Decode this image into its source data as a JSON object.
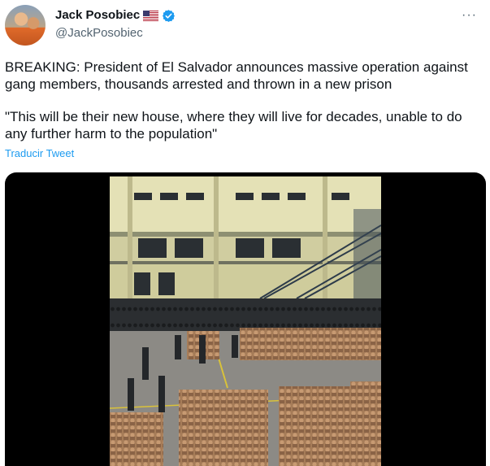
{
  "author": {
    "name": "Jack Posobiec",
    "handle": "@JackPosobiec",
    "flag_icon": "us-flag-icon",
    "verified_icon": "verified-badge-icon"
  },
  "more_label": "···",
  "tweet": {
    "paragraphs": [
      "BREAKING: President of El Salvador announces massive operation against gang members, thousands arrested and thrown in a new prison",
      "\"This will be their new house, where they will live for decades, unable to do any further harm to the population\""
    ],
    "translate_label": "Traducir Tweet"
  },
  "colors": {
    "link": "#1d9bf0",
    "secondary_text": "#536471",
    "verified": "#1d9bf0"
  }
}
